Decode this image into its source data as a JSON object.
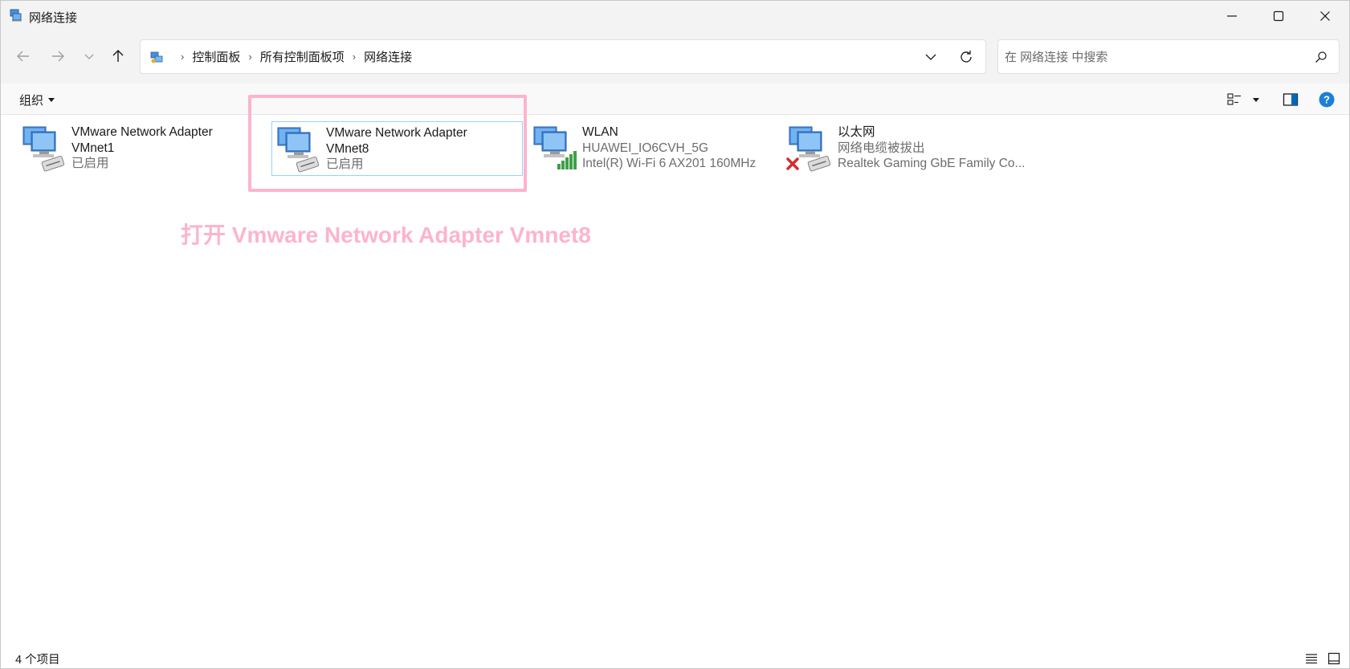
{
  "window": {
    "title": "网络连接",
    "accent": "#0078d4",
    "annotation_color": "#fcb4cc"
  },
  "nav": {
    "breadcrumbs": [
      "控制面板",
      "所有控制面板项",
      "网络连接"
    ],
    "search_placeholder": "在 网络连接 中搜索"
  },
  "command_bar": {
    "organize_label": "组织"
  },
  "items": [
    {
      "name": "VMware Network Adapter",
      "name2": "VMnet1",
      "status": "已启用",
      "device": "",
      "icon": "network-adapter-icon"
    },
    {
      "name": "VMware Network Adapter",
      "name2": "VMnet8",
      "status": "已启用",
      "device": "",
      "icon": "network-adapter-icon"
    },
    {
      "name": "WLAN",
      "name2": "",
      "status": "HUAWEI_IO6CVH_5G",
      "device": "Intel(R) Wi-Fi 6 AX201 160MHz",
      "icon": "wifi-adapter-icon"
    },
    {
      "name": "以太网",
      "name2": "",
      "status": "网络电缆被拔出",
      "device": "Realtek Gaming GbE Family Co...",
      "icon": "ethernet-disconnected-icon"
    }
  ],
  "annotation": {
    "text": "打开 Vmware Network Adapter Vmnet8"
  },
  "status_bar": {
    "item_count": "4 个项目"
  }
}
